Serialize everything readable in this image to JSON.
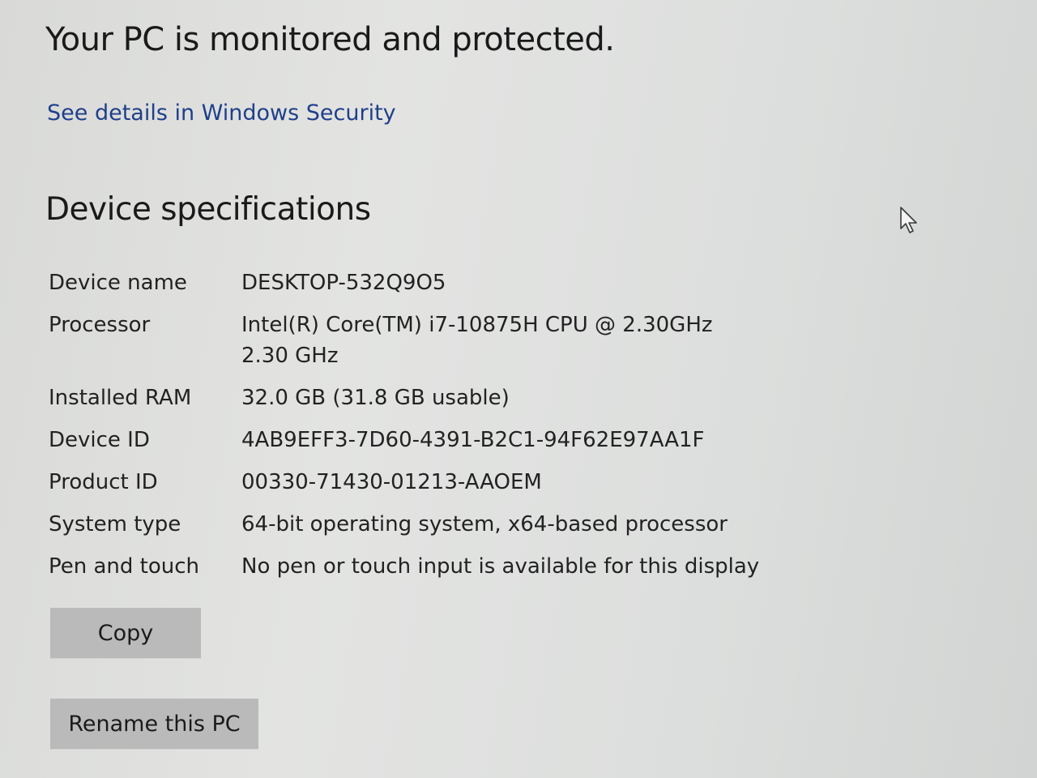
{
  "security": {
    "status_heading": "Your PC is monitored and protected.",
    "details_link": "See details in Windows Security"
  },
  "specs": {
    "heading": "Device specifications",
    "rows": [
      {
        "label": "Device name",
        "value": "DESKTOP-532Q9O5"
      },
      {
        "label": "Processor",
        "value": "Intel(R) Core(TM) i7-10875H CPU @ 2.30GHz   2.30 GHz"
      },
      {
        "label": "Installed RAM",
        "value": "32.0 GB (31.8 GB usable)"
      },
      {
        "label": "Device ID",
        "value": "4AB9EFF3-7D60-4391-B2C1-94F62E97AA1F"
      },
      {
        "label": "Product ID",
        "value": "00330-71430-01213-AAOEM"
      },
      {
        "label": "System type",
        "value": "64-bit operating system, x64-based processor"
      },
      {
        "label": "Pen and touch",
        "value": "No pen or touch input is available for this display"
      }
    ]
  },
  "actions": {
    "copy_label": "Copy",
    "rename_label": "Rename this PC"
  },
  "icons": {
    "cursor": "mouse-pointer-icon"
  },
  "colors": {
    "link": "#1f3f8a",
    "button_bg": "#b9bab9"
  }
}
